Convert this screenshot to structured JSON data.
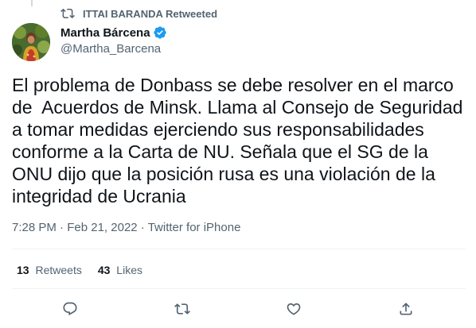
{
  "retweet_banner": {
    "text": "ITTAI BARANDA Retweeted",
    "icon": "retweet-icon"
  },
  "author": {
    "name": "Martha Bárcena",
    "handle": "@Martha_Barcena",
    "verified": true
  },
  "tweet": {
    "text": "El problema de Donbass se debe resolver en el marco\nde  Acuerdos de Minsk. Llama al Consejo de Seguridad\na tomar medidas ejerciendo sus responsabilidades\nconforme a la Carta de NU. Señala que el SG de la\nONU dijo que la posición rusa es una violación de la\nintegridad de Ucrania",
    "time": "7:28 PM",
    "date": "Feb 21, 2022",
    "source": "Twitter for iPhone"
  },
  "stats": {
    "retweets_count": "13",
    "retweets_label": "Retweets",
    "likes_count": "43",
    "likes_label": "Likes"
  },
  "actions": [
    {
      "name": "reply",
      "icon": "reply-icon"
    },
    {
      "name": "retweet",
      "icon": "retweet-icon"
    },
    {
      "name": "like",
      "icon": "heart-icon"
    },
    {
      "name": "share",
      "icon": "share-icon"
    }
  ],
  "colors": {
    "text_primary": "#0f1419",
    "text_secondary": "#536471",
    "verified_blue": "#1d9bf0",
    "divider": "#eff3f4"
  }
}
